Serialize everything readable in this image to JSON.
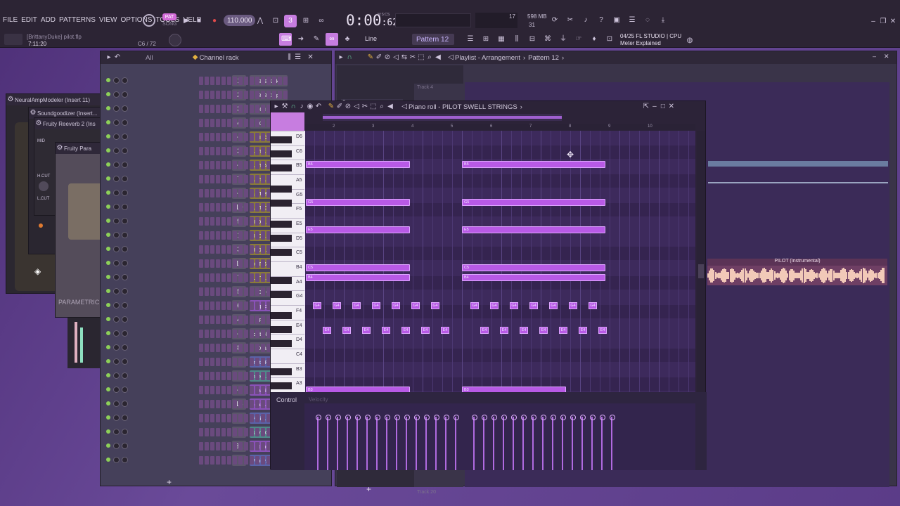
{
  "menu": {
    "items": [
      "FILE",
      "EDIT",
      "ADD",
      "PATTERNS",
      "VIEW",
      "OPTIONS",
      "TOOLS",
      "HELP"
    ]
  },
  "transport": {
    "pat_label": "PAT",
    "song_label": "SONG",
    "tempo": "110.000",
    "time_main": "0:00",
    "time_sub": ":62",
    "time_unit": "M:S:CS",
    "mem_top": "17",
    "mem_mb": "598 MB",
    "mem_bottom": "31"
  },
  "project": {
    "hint": "[BrittanyDuke] pilot.flp",
    "song_time": "7:11:20",
    "note_pos": "C6 / 72"
  },
  "toolbar": {
    "snap": "Line",
    "pattern": "Pattern 12",
    "cpu_hint_top": "04/25  FL STUDIO | CPU",
    "cpu_hint_bottom": "Meter Explained"
  },
  "channel_rack": {
    "title": "Channel rack",
    "filter": "All",
    "channels": [
      {
        "num": "1",
        "name": "808 Kick",
        "color": "#5b556a"
      },
      {
        "num": "2",
        "name": "808 Clap",
        "color": "#5b556a"
      },
      {
        "num": "3",
        "name": "808 HiHat",
        "color": "#5b556a"
      },
      {
        "num": "4",
        "name": "808 Snare",
        "color": "#5b556a"
      },
      {
        "num": "---",
        "name": "PILO...ntal)",
        "color": "#8a7a3a"
      },
      {
        "num": "2",
        "name": "PILOT...SE SLIDE",
        "color": "#8a7a3a"
      },
      {
        "num": "---",
        "name": "PILOT A...P LEAD",
        "color": "#8a7a3a"
      },
      {
        "num": "7",
        "name": "PILOT...OG LEAD",
        "color": "#8a7a3a"
      },
      {
        "num": "---",
        "name": "PILOT B...S LEAD",
        "color": "#8a7a3a"
      },
      {
        "num": "10",
        "name": "PILOT C...2 LEAD",
        "color": "#8a7a3a"
      },
      {
        "num": "9",
        "name": "PILOT...STRING",
        "color": "#8a7a3a"
      },
      {
        "num": "1",
        "name": "PILOT...LIDEEE",
        "color": "#8a7a3a"
      },
      {
        "num": "3",
        "name": "PILOT...OUNGE",
        "color": "#8a7a3a"
      },
      {
        "num": "11",
        "name": "PILOT S...TRINGS",
        "color": "#8a7a3a"
      },
      {
        "num": "7",
        "name": "PILOT...ON LEAD",
        "color": "#8a7a3a"
      },
      {
        "num": "5",
        "name": "808 Conga",
        "color": "#5b556a"
      },
      {
        "num": "6",
        "name": "arp b...nner",
        "color": "#8a52b8"
      },
      {
        "num": "4",
        "name": "FL Keys",
        "color": "#5b556a"
      },
      {
        "num": "---",
        "name": "Cowbell (PILOT)",
        "color": "#5b556a"
      },
      {
        "num": "8",
        "name": "DPiano-E",
        "color": "#5b556a"
      },
      {
        "num": "",
        "name": "Fruity F...x level",
        "color": "#5b62a8"
      },
      {
        "num": "",
        "name": "Insert...Volume",
        "color": "#4f8a8a"
      },
      {
        "num": "---",
        "name": "can i...ts op",
        "color": "#8a52b8"
      },
      {
        "num": "15",
        "name": "can...drums",
        "color": "#8a52b8"
      },
      {
        "num": "",
        "name": "Fruity...ix level",
        "color": "#5b62a8"
      },
      {
        "num": "",
        "name": "PILOT C...anning",
        "color": "#4f8a8a"
      },
      {
        "num": "32",
        "name": "at the fcukl",
        "color": "#8a52b8"
      },
      {
        "num": "",
        "name": "Fruity...x level",
        "color": "#5b62a8"
      }
    ]
  },
  "playlist": {
    "title": "Playlist - Arrangement",
    "pattern": "Pattern 12",
    "track_top": "Track 4",
    "track_bottom": "Track 20",
    "clip_label": "PILOT (Instrumental)",
    "pattern_num": "3"
  },
  "piano_roll": {
    "title": "Piano roll - PILOT SWELL STRINGS",
    "keys": [
      "D6",
      "C6",
      "B5",
      "A5",
      "G5",
      "F5",
      "E5",
      "D5",
      "C5",
      "B4",
      "A4",
      "G4",
      "F4",
      "E4",
      "D4",
      "C4",
      "B3",
      "A3"
    ],
    "ruler": [
      "2",
      "3",
      "4",
      "5",
      "6",
      "7",
      "8",
      "9",
      "10"
    ],
    "control_label": "Control",
    "control_target": "Velocity",
    "notes": [
      {
        "label": "B5",
        "lane": 2,
        "start": 0,
        "len": 8
      },
      {
        "label": "B5",
        "lane": 2,
        "start": 12,
        "len": 11
      },
      {
        "label": "G5",
        "lane": 4.6,
        "start": 0,
        "len": 8
      },
      {
        "label": "G5",
        "lane": 4.6,
        "start": 12,
        "len": 11
      },
      {
        "label": "E5",
        "lane": 6.5,
        "start": 0,
        "len": 8
      },
      {
        "label": "E5",
        "lane": 6.5,
        "start": 12,
        "len": 11
      },
      {
        "label": "C5",
        "lane": 9.1,
        "start": 0,
        "len": 8
      },
      {
        "label": "C5",
        "lane": 9.1,
        "start": 12,
        "len": 11
      },
      {
        "label": "B4",
        "lane": 9.75,
        "start": 0,
        "len": 8
      },
      {
        "label": "B4",
        "lane": 9.75,
        "start": 12,
        "len": 11
      },
      {
        "label": "B3",
        "lane": 17.5,
        "start": 0,
        "len": 8
      },
      {
        "label": "B3",
        "lane": 17.5,
        "start": 12,
        "len": 8
      }
    ],
    "short_notes_g4": [
      "G4",
      "G4",
      "G4",
      "G4",
      "G4",
      "G4",
      "G4",
      "G4",
      "G4",
      "G4",
      "G4",
      "G4",
      "G4",
      "G4"
    ],
    "short_notes_e4": [
      "E4",
      "E4",
      "E4",
      "E4",
      "E4",
      "E4",
      "E4",
      "E4",
      "E4",
      "E4",
      "E4",
      "E4",
      "E4",
      "E4"
    ]
  },
  "plugins": {
    "neural": "NeuralAmpModeler (Insert 11)",
    "sound": "Soundgoodizer (Insert...",
    "reverb": "Fruity Reeverb 2 (Ins",
    "parametric": "Fruity Para",
    "param_label": "PARAMETRIC",
    "h_cut": "H.CUT",
    "l_cut": "L.CUT"
  },
  "colors": {
    "accent": "#b85ae6",
    "brand": "#d36bd8"
  }
}
